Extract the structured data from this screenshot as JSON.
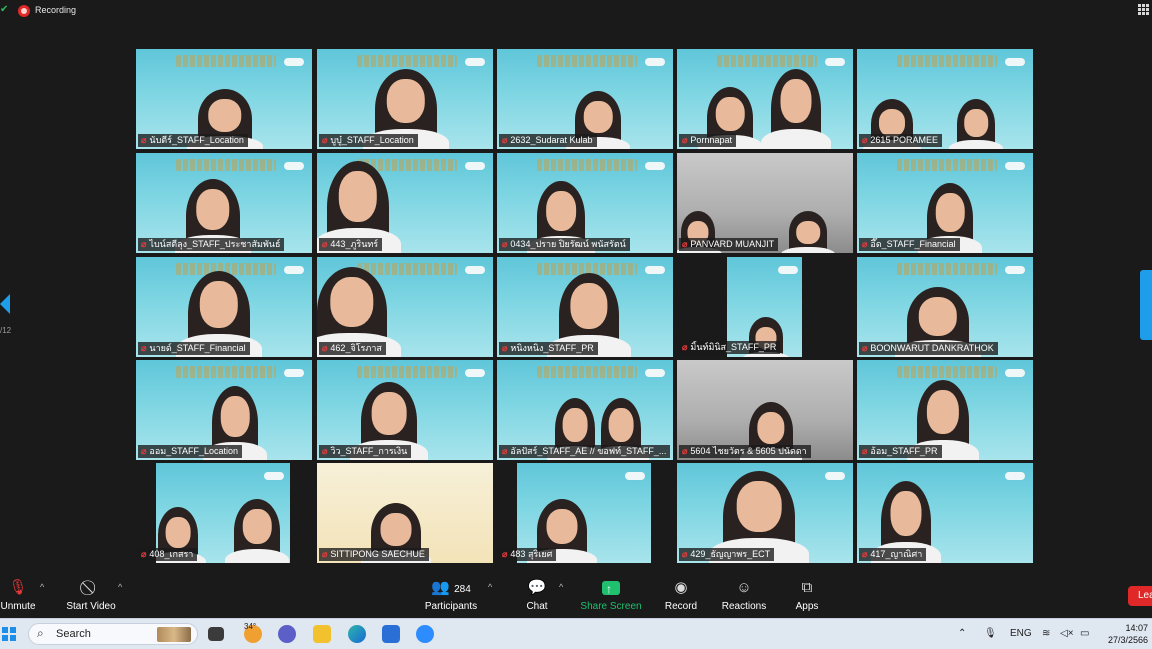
{
  "topbar": {
    "recording_label": "Recording"
  },
  "gallery": {
    "page_indicator": "/12",
    "tiles": [
      {
        "name": "นับตีร์_STAFF_Location"
      },
      {
        "name": "บูบู๋_STAFF_Location"
      },
      {
        "name": "2632_Sudarat Kulab"
      },
      {
        "name": "Pornnapat"
      },
      {
        "name": "2615 PORAMEE"
      },
      {
        "name": "ไบน์สตีลุง_STAFF_ประชาสัมพันธ์"
      },
      {
        "name": "443_ภูรินทร์"
      },
      {
        "name": "0434_ปราย ปิยรัฒน์ พนัสรัตน์"
      },
      {
        "name": "PANVARD MUANJIT"
      },
      {
        "name": "อึ๊ด_STAFF_Financial"
      },
      {
        "name": "นายด์_STAFF_Financial"
      },
      {
        "name": "462_จิโรภาส"
      },
      {
        "name": "หนิงหนิง_STAFF_PR"
      },
      {
        "name": "มิ้นท์มินิส_STAFF_PR"
      },
      {
        "name": "BOONWARUT DANKRATHOK"
      },
      {
        "name": "ออม_STAFF_Location"
      },
      {
        "name": "วิว_STAFF_การเงิน"
      },
      {
        "name": "อัลปัสร์_STAFF_AE // ขอฟท์_STAFF_..."
      },
      {
        "name": "5604 ไชยวัตร & 5605 ปนัดดา"
      },
      {
        "name": "อ้อม_STAFF_PR"
      },
      {
        "name": "408_เกสรา"
      },
      {
        "name": "SITTIPONG SAECHUE"
      },
      {
        "name": "483 สุริเยศ"
      },
      {
        "name": "429_ธัญญาพร_ECT"
      },
      {
        "name": "417_ญาณิศา"
      }
    ]
  },
  "toolbar": {
    "unmute": "Unmute",
    "start_video": "Start Video",
    "participants_count": "284",
    "participants": "Participants",
    "chat": "Chat",
    "share_screen": "Share Screen",
    "record": "Record",
    "reactions": "Reactions",
    "apps": "Apps",
    "leave": "Lea"
  },
  "taskbar": {
    "search": "Search",
    "weather": "34°",
    "language": "ENG",
    "time": "14:07",
    "date": "27/3/2566"
  },
  "colors": {
    "accent": "#1e9dea",
    "share": "#1fc06e",
    "mic_off": "#e33b3b",
    "leave": "#e02828"
  }
}
